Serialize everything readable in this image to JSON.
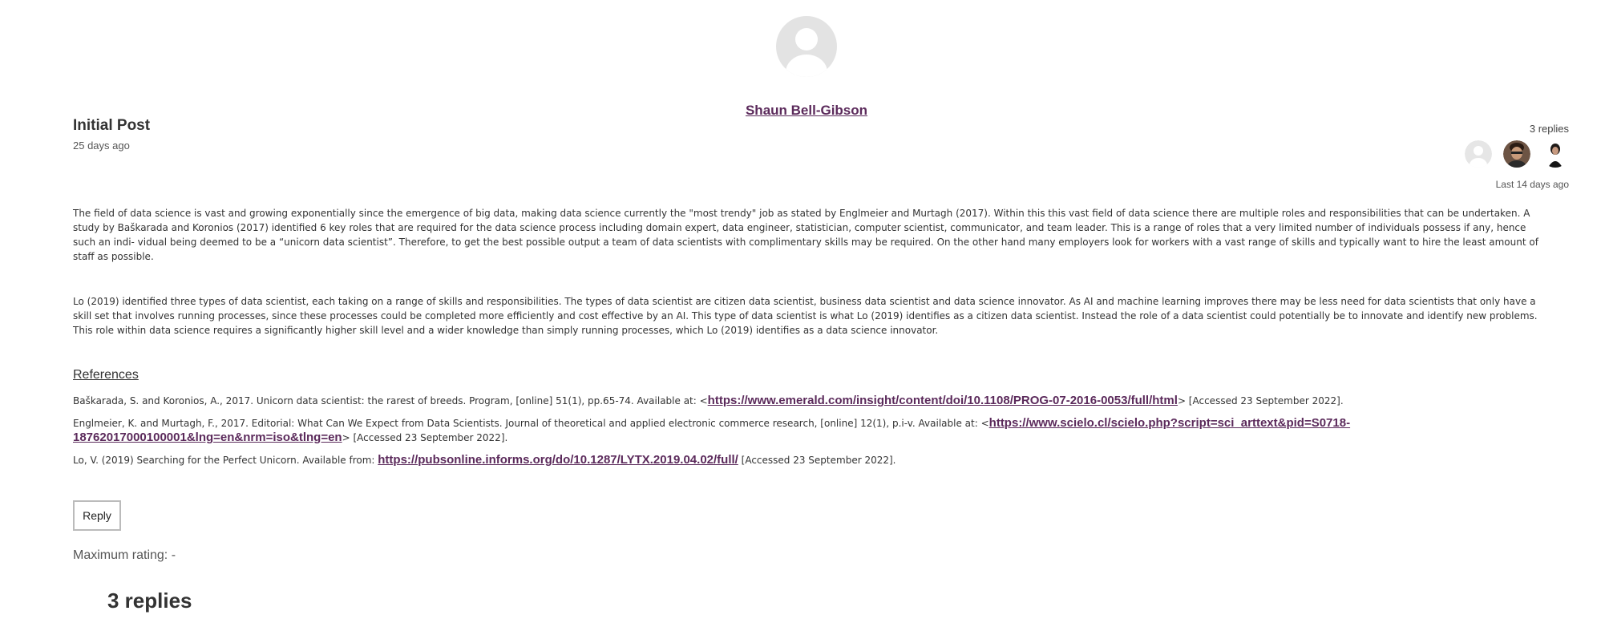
{
  "author": {
    "name": "Shaun Bell-Gibson"
  },
  "post": {
    "title": "Initial Post",
    "date": "25 days ago",
    "replies_count": "3 replies",
    "last_reply": "Last 14 days ago",
    "paragraphs": [
      "The field of data science is vast and growing exponentially since the emergence of big data, making data science currently the \"most trendy\" job as stated by Englmeier and Murtagh (2017). Within this this vast field of data science there are multiple roles and responsibilities that can be undertaken. A study by Baškarada and Koronios (2017) identified 6 key roles that are required for the data science process including domain expert, data engineer, statistician, computer scientist, communicator, and team leader. This is a range of roles that a very limited number of individuals possess if any, hence such an indi- vidual being deemed to be a “unicorn data scientist”. Therefore, to get the best possible output a team of data scientists with complimentary skills may be required. On the other hand many employers look for workers with a vast range of skills and typically want to hire the least amount of staff as possible.",
      "Lo (2019) identified three types of data scientist, each taking on a range of skills and responsibilities. The types of data scientist are citizen data scientist, business data scientist and data science innovator. As AI and machine learning improves there may be less need for data scientists that only have a skill set that involves running processes, since these processes could be completed more efficiently and cost effective by an AI. This type of data scientist is what Lo (2019) identifies as a citizen data scientist. Instead the role of a data scientist could potentially be to innovate and identify new problems. This role within data science requires a significantly higher skill level and a wider knowledge than simply running processes, which Lo (2019) identifies as a data science innovator."
    ],
    "references_heading": "References",
    "references": [
      {
        "before": "Baškarada, S. and Koronios, A., 2017. Unicorn data scientist: the rarest of breeds. Program, [online] 51(1), pp.65-74. Available at: <",
        "link": "https://www.emerald.com/insight/content/doi/10.1108/PROG-07-2016-0053/full/html",
        "after": "> [Accessed 23 September 2022]."
      },
      {
        "before": "Englmeier, K. and Murtagh, F., 2017. Editorial: What Can We Expect from Data Scientists. Journal of theoretical and applied electronic commerce research, [online] 12(1), p.i-v. Available at: <",
        "link": "https://www.scielo.cl/scielo.php?script=sci_arttext&pid=S0718-18762017000100001&lng=en&nrm=iso&tlng=en",
        "after": "> [Accessed 23 September 2022]."
      },
      {
        "before": "Lo, V. (2019) Searching for the Perfect Unicorn. Available from: ",
        "link": "https://pubsonline.informs.org/do/10.1287/LYTX.2019.04.02/full/",
        "after": " [Accessed 23 September 2022]."
      }
    ]
  },
  "actions": {
    "reply_label": "Reply",
    "max_rating": "Maximum rating: -"
  },
  "replies_section": {
    "heading": "3 replies"
  },
  "colors": {
    "link": "#5b2a5b",
    "avatar_placeholder": "#e3e3e3"
  }
}
